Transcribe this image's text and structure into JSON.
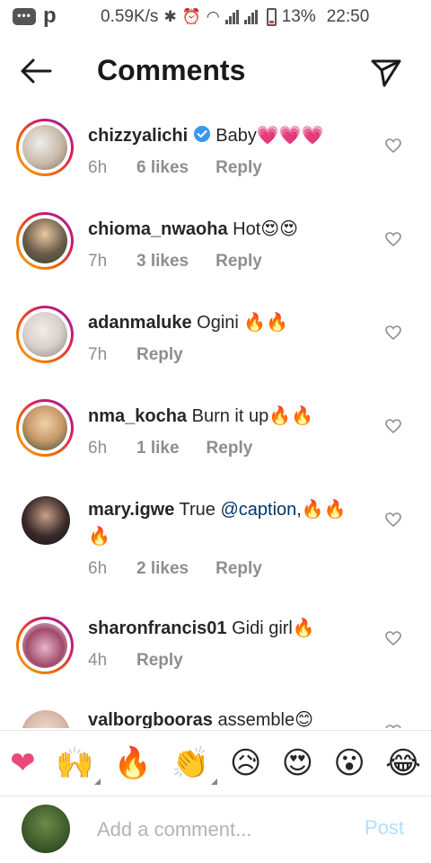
{
  "status_bar": {
    "speed": "0.59K/s",
    "battery": "13%",
    "time": "22:50",
    "icons": [
      "chat-icon",
      "p-icon",
      "bluetooth-icon",
      "alarm-icon",
      "wifi-icon",
      "signal-icon",
      "battery-icon"
    ]
  },
  "header": {
    "title": "Comments",
    "back_icon": "arrow-left-icon",
    "share_icon": "send-icon"
  },
  "comments": [
    {
      "username": "chizzyalichi",
      "verified": true,
      "text": " Baby💗💗💗",
      "time": "6h",
      "likes": "6 likes",
      "reply": "Reply",
      "avatar_color": "#c9b9a8"
    },
    {
      "username": "chioma_nwaoha",
      "verified": false,
      "text": " Hot😍😍",
      "time": "7h",
      "likes": "3 likes",
      "reply": "Reply",
      "avatar_color": "#6a5a4a"
    },
    {
      "username": "adanmaluke",
      "verified": false,
      "text": " Ogini 🔥🔥",
      "time": "7h",
      "likes": "",
      "reply": "Reply",
      "avatar_color": "#d8d0cc"
    },
    {
      "username": "nma_kocha",
      "verified": false,
      "text": " Burn it up🔥🔥",
      "time": "6h",
      "likes": "1 like",
      "reply": "Reply",
      "avatar_color": "#c79a6a"
    },
    {
      "username": "mary.igwe",
      "verified": false,
      "text_before": " True ",
      "mention": "@caption",
      "text_after": ",🔥🔥🔥",
      "time": "6h",
      "likes": "2 likes",
      "reply": "Reply",
      "avatar_color": "#3a2a2a"
    },
    {
      "username": "sharonfrancis01",
      "verified": false,
      "text": " Gidi girl🔥",
      "time": "4h",
      "likes": "",
      "reply": "Reply",
      "avatar_color": "#a04a6a"
    },
    {
      "username": "valborgbooras",
      "verified": false,
      "text": " assemble😊",
      "time": "",
      "likes": "",
      "reply": "",
      "avatar_color": "#d9b8a8"
    }
  ],
  "emoji_bar": [
    "❤",
    "🙌",
    "🔥",
    "👏",
    "😥",
    "😍",
    "😮",
    "😂"
  ],
  "composer": {
    "placeholder": "Add a comment...",
    "post_label": "Post"
  },
  "colors": {
    "accent_ring": "#d81b60",
    "verified": "#3897f0",
    "mention": "#00376b",
    "meta": "#8e8e8e",
    "post_disabled": "#b2dffc"
  }
}
